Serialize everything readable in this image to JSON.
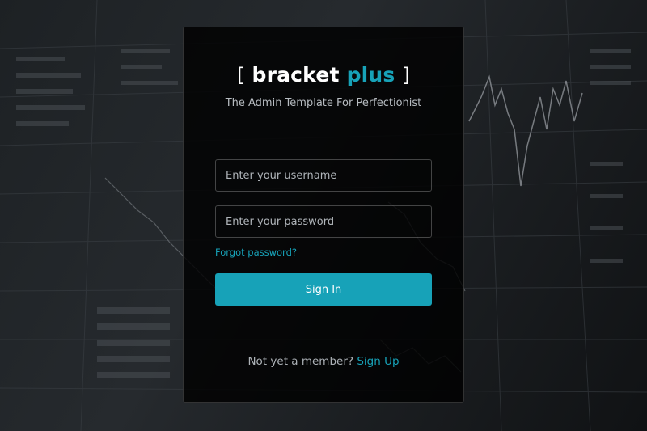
{
  "brand": {
    "open_bracket": "[",
    "name_main": "bracket",
    "name_accent": "plus",
    "close_bracket": "]",
    "tagline": "The Admin Template For Perfectionist"
  },
  "form": {
    "username_placeholder": "Enter your username",
    "password_placeholder": "Enter your password",
    "forgot_label": "Forgot password?",
    "signin_label": "Sign In"
  },
  "footer": {
    "member_text": "Not yet a member?",
    "signup_label": "Sign Up"
  },
  "colors": {
    "accent": "#17a2b8",
    "card_bg": "#000000",
    "page_bg": "#151719"
  }
}
